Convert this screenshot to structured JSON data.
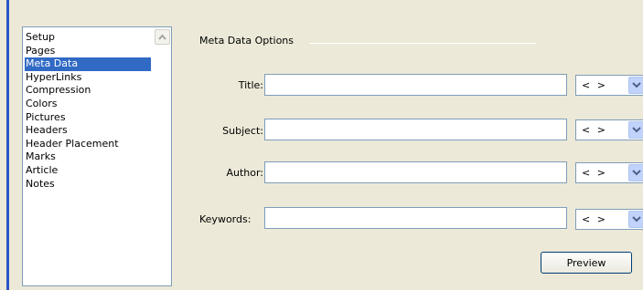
{
  "nav": {
    "items": [
      {
        "label": "Setup",
        "selected": false
      },
      {
        "label": "Pages",
        "selected": false
      },
      {
        "label": "Meta Data",
        "selected": true
      },
      {
        "label": "HyperLinks",
        "selected": false
      },
      {
        "label": "Compression",
        "selected": false
      },
      {
        "label": "Colors",
        "selected": false
      },
      {
        "label": "Pictures",
        "selected": false
      },
      {
        "label": "Headers",
        "selected": false
      },
      {
        "label": "Header Placement",
        "selected": false
      },
      {
        "label": "Marks",
        "selected": false
      },
      {
        "label": "Article",
        "selected": false
      },
      {
        "label": "Notes",
        "selected": false
      }
    ]
  },
  "group": {
    "title": "Meta Data Options"
  },
  "fields": {
    "title": {
      "label": "Title:",
      "value": "",
      "option": "< >"
    },
    "subject": {
      "label": "Subject:",
      "value": "",
      "option": "< >"
    },
    "author": {
      "label": "Author:",
      "value": "",
      "option": "< >"
    },
    "keywords": {
      "label": "Keywords:",
      "value": "",
      "option": "< >"
    }
  },
  "buttons": {
    "preview_label": "Preview"
  },
  "colors": {
    "selection": "#316ac5",
    "background": "#ece9d8",
    "border": "#7f9db9"
  },
  "icons": {
    "scroll_up": "chevron-up-icon",
    "dropdown": "chevron-down-icon"
  }
}
